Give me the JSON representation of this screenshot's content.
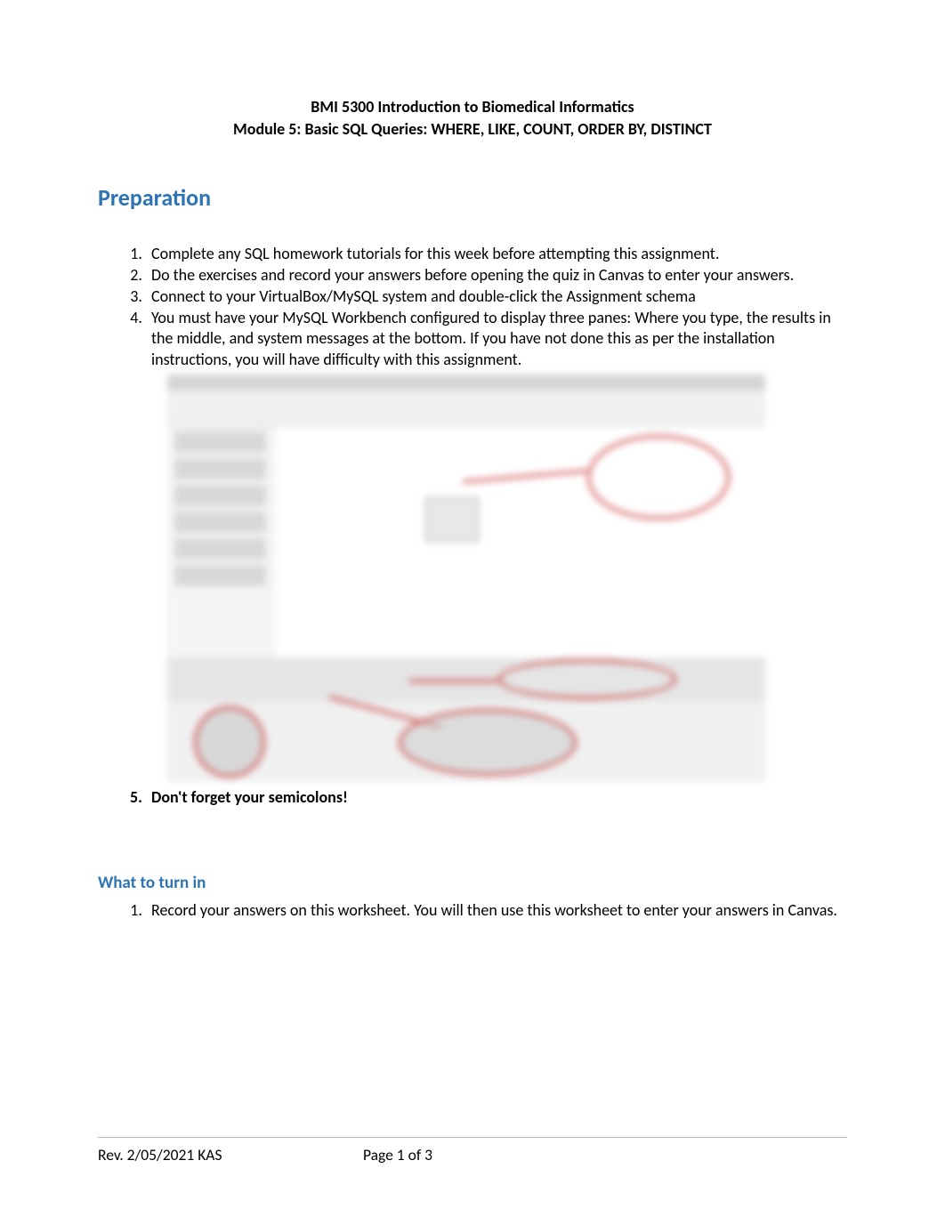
{
  "header": {
    "line1": "BMI 5300 Introduction to Biomedical Informatics",
    "line2": "Module 5: Basic SQL Queries: WHERE, LIKE, COUNT, ORDER BY, DISTINCT"
  },
  "section_title": "Preparation",
  "prep_list": {
    "item1": "Complete any SQL homework tutorials for this week before attempting this assignment.",
    "item2": "Do the exercises and record your answers before opening the quiz in Canvas to enter your answers.",
    "item3": "Connect to your VirtualBox/MySQL system and double-click the Assignment schema",
    "item4": "You must have your MySQL Workbench configured to display three panes: Where you type, the results in the middle, and system messages at the bottom. If you have not done this as per the installation instructions, you will have difficulty with this assignment.",
    "item5": "Don't forget your semicolons!"
  },
  "subsection_title": "What to turn in",
  "turnin_list": {
    "item1": "Record your answers on this worksheet. You will then use this worksheet to enter your answers in Canvas."
  },
  "footer": {
    "revision": "Rev. 2/05/2021 KAS",
    "page": "Page 1 of 3"
  }
}
